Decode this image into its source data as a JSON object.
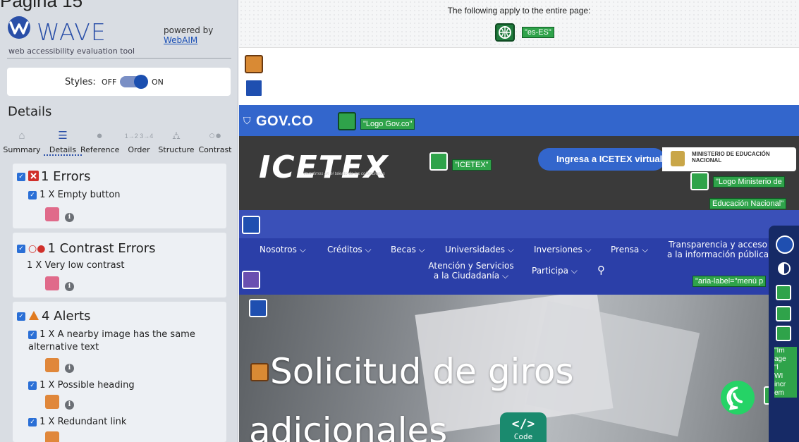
{
  "page_caption": "Página 15",
  "wave": {
    "brand": "WAVE",
    "tagline": "web accessibility evaluation tool",
    "powered_by": "powered by",
    "powered_link": "WebAIM",
    "styles_label": "Styles:",
    "styles_off": "OFF",
    "styles_on": "ON",
    "details_title": "Details",
    "tabs": [
      {
        "label": "Summary",
        "icon": "home-icon"
      },
      {
        "label": "Details",
        "icon": "list-icon"
      },
      {
        "label": "Reference",
        "icon": "info-icon"
      },
      {
        "label": "Order",
        "icon": "order-icon"
      },
      {
        "label": "Structure",
        "icon": "structure-icon"
      },
      {
        "label": "Contrast",
        "icon": "contrast-icon"
      }
    ],
    "errors": {
      "title": "1 Errors",
      "item": "1 X Empty button"
    },
    "contrast": {
      "title": "1 Contrast Errors",
      "item": "1 X Very low contrast"
    },
    "alerts": {
      "title": "4 Alerts",
      "items": [
        "1 X A nearby image has the same alternative text",
        "1 X Possible heading",
        "1 X Redundant link"
      ]
    }
  },
  "main": {
    "apply_text": "The following apply to the entire page:",
    "lang_tag": "\"es-ES\"",
    "gov_text": "GOV.CO",
    "gov_logo_tag": "\"Logo Gov.co\"",
    "icetex_logo": "ICETEX",
    "icetex_tagline": "invertimos en el talento de los colombianos",
    "icetex_tag": "\"ICETEX\"",
    "virtual_button": "Ingresa a ICETEX virtual",
    "ministry": "MINISTERIO DE EDUCACIÓN NACIONAL",
    "ministry_tag_line1": "\"Logo Ministerio de",
    "ministry_tag_line2": "Educación Nacional\"",
    "nav": {
      "nosotros": "Nosotros ⌵",
      "creditos": "Créditos ⌵",
      "becas": "Becas ⌵",
      "universidades": "Universidades ⌵",
      "inversiones": "Inversiones ⌵",
      "prensa": "Prensa ⌵",
      "transparencia_1": "Transparencia y acceso",
      "transparencia_2": "a la información pública",
      "atencion_1": "Atención y Servicios",
      "atencion_2": "a la Ciudadanía ⌵",
      "participa": "Participa ⌵"
    },
    "aria_label_tag": "\"aria-label=\"menú p",
    "hero_title_1": "Solicitud de giros",
    "hero_title_2": "adicionales",
    "code_label": "Code",
    "rail_tags": [
      "\"Im",
      "age",
      "\"l",
      "WI",
      "incr",
      "em"
    ]
  },
  "colors": {
    "wave_blue": "#2a4fa8",
    "gov_blue": "#3366cc",
    "nav_blue": "#2b3fa8",
    "wave_green": "#2fa34a",
    "error_red": "#d0302b",
    "alert_orange": "#e07a1f"
  }
}
